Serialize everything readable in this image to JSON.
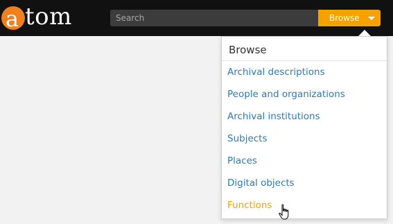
{
  "logo": {
    "mark_letter": "a",
    "text": "tom"
  },
  "search": {
    "placeholder": "Search",
    "value": ""
  },
  "browse_button": {
    "label": "Browse",
    "icon": "caret-down-icon"
  },
  "browse_menu": {
    "title": "Browse",
    "items": [
      {
        "label": "Archival descriptions",
        "active": false
      },
      {
        "label": "People and organizations",
        "active": false
      },
      {
        "label": "Archival institutions",
        "active": false
      },
      {
        "label": "Subjects",
        "active": false
      },
      {
        "label": "Places",
        "active": false
      },
      {
        "label": "Digital objects",
        "active": false
      },
      {
        "label": "Functions",
        "active": true
      }
    ]
  },
  "colors": {
    "topbar": "#111111",
    "logo_orange": "#f07f1d",
    "accent": "#f5a100",
    "link": "#2a7ab8",
    "page_bg": "#f2f2f2"
  }
}
